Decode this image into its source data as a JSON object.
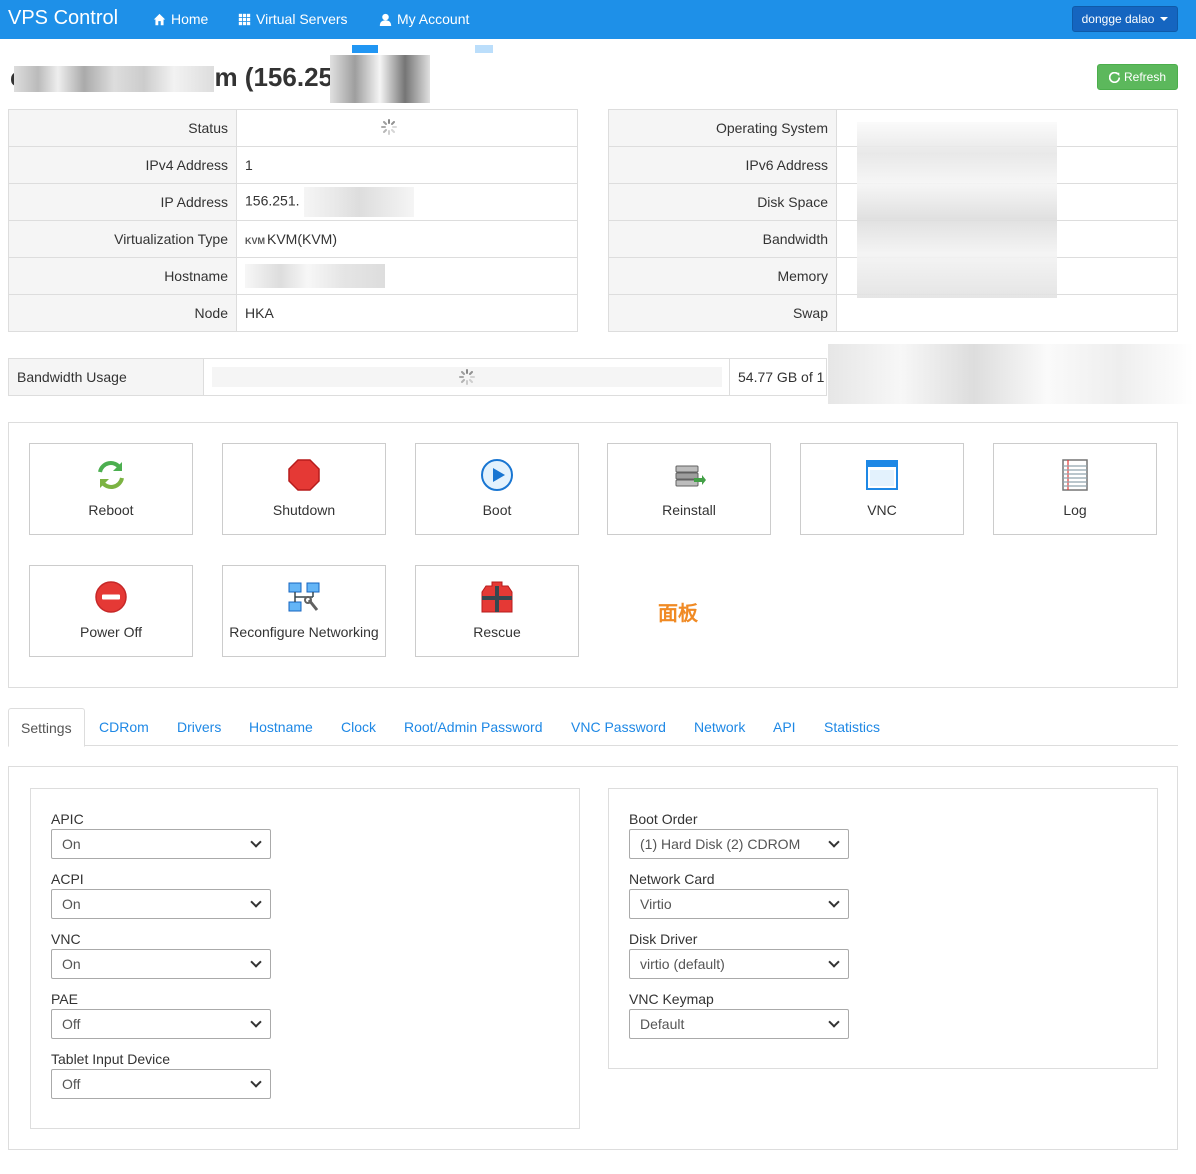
{
  "navbar": {
    "brand": "VPS Control",
    "links": [
      {
        "label": "Home",
        "icon": "home-icon"
      },
      {
        "label": "Virtual Servers",
        "icon": "grid-icon"
      },
      {
        "label": "My Account",
        "icon": "user-icon"
      }
    ],
    "user_menu": "dongge dalao"
  },
  "page": {
    "title_visible": "m (156.251",
    "title_prefix_visible": "c",
    "refresh_label": "Refresh"
  },
  "info_left": [
    {
      "label": "Status",
      "value": ""
    },
    {
      "label": "IPv4 Address",
      "value": "1"
    },
    {
      "label": "IP Address",
      "value": "156.251."
    },
    {
      "label": "Virtualization Type",
      "value": "KVM(KVM)"
    },
    {
      "label": "Hostname",
      "value": ""
    },
    {
      "label": "Node",
      "value": "HKA"
    }
  ],
  "info_right": [
    {
      "label": "Operating System",
      "value": ""
    },
    {
      "label": "IPv6 Address",
      "value": ""
    },
    {
      "label": "Disk Space",
      "value": ""
    },
    {
      "label": "Bandwidth",
      "value": ""
    },
    {
      "label": "Memory",
      "value": ""
    },
    {
      "label": "Swap",
      "value": ""
    }
  ],
  "bandwidth": {
    "label": "Bandwidth Usage",
    "value": "54.77 GB of 1"
  },
  "actions": [
    {
      "label": "Reboot",
      "icon": "reboot-icon"
    },
    {
      "label": "Shutdown",
      "icon": "shutdown-icon"
    },
    {
      "label": "Boot",
      "icon": "boot-icon"
    },
    {
      "label": "Reinstall",
      "icon": "reinstall-icon"
    },
    {
      "label": "VNC",
      "icon": "vnc-icon"
    },
    {
      "label": "Log",
      "icon": "log-icon"
    },
    {
      "label": "Power Off",
      "icon": "power-off-icon"
    },
    {
      "label": "Reconfigure Networking",
      "icon": "network-icon"
    },
    {
      "label": "Rescue",
      "icon": "rescue-icon"
    }
  ],
  "panel_note": "面板",
  "tabs": [
    "Settings",
    "CDRom",
    "Drivers",
    "Hostname",
    "Clock",
    "Root/Admin Password",
    "VNC Password",
    "Network",
    "API",
    "Statistics"
  ],
  "settings_left": [
    {
      "label": "APIC",
      "value": "On"
    },
    {
      "label": "ACPI",
      "value": "On"
    },
    {
      "label": "VNC",
      "value": "On"
    },
    {
      "label": "PAE",
      "value": "Off"
    },
    {
      "label": "Tablet Input Device",
      "value": "Off"
    }
  ],
  "settings_right": [
    {
      "label": "Boot Order",
      "value": "(1) Hard Disk (2) CDROM"
    },
    {
      "label": "Network Card",
      "value": "Virtio"
    },
    {
      "label": "Disk Driver",
      "value": "virtio (default)"
    },
    {
      "label": "VNC Keymap",
      "value": "Default"
    }
  ],
  "colors": {
    "navbar": "#1e90e8",
    "user_button": "#1565c0",
    "refresh_button": "#5cb85c",
    "link": "#1e88e5",
    "panel_note": "#f08a24"
  }
}
